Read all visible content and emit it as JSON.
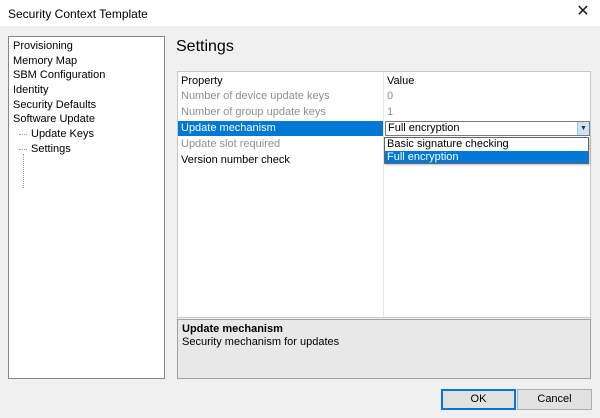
{
  "window": {
    "title": "Security Context Template",
    "close_glyph": "✕"
  },
  "tree": {
    "items": [
      {
        "label": "Provisioning",
        "level": 0
      },
      {
        "label": "Memory Map",
        "level": 0
      },
      {
        "label": "SBM Configuration",
        "level": 0
      },
      {
        "label": "Identity",
        "level": 0
      },
      {
        "label": "Security Defaults",
        "level": 0
      },
      {
        "label": "Software Update",
        "level": 0
      },
      {
        "label": "Update Keys",
        "level": 1
      },
      {
        "label": "Settings",
        "level": 1
      }
    ]
  },
  "settings": {
    "title": "Settings"
  },
  "grid": {
    "header": {
      "property": "Property",
      "value": "Value"
    },
    "rows": [
      {
        "property": "Number of device update keys",
        "value": "0",
        "state": "disabled"
      },
      {
        "property": "Number of group update keys",
        "value": "1",
        "state": "disabled"
      },
      {
        "property": "Update mechanism",
        "value": "Full encryption",
        "state": "selected"
      },
      {
        "property": "Update slot required",
        "value": "",
        "state": "disabled"
      },
      {
        "property": "Version number check",
        "value": "",
        "state": "normal"
      }
    ]
  },
  "dropdown": {
    "arrow_glyph": "▼",
    "options": [
      "Basic signature checking",
      "Full encryption"
    ],
    "highlighted": "Full encryption"
  },
  "description": {
    "title": "Update mechanism",
    "text": "Security mechanism for updates"
  },
  "buttons": {
    "ok": "OK",
    "cancel": "Cancel"
  },
  "colors": {
    "selection": "#0078d7",
    "disabled_text": "#8f8f8f",
    "dialog_bg": "#f0f0f0"
  }
}
